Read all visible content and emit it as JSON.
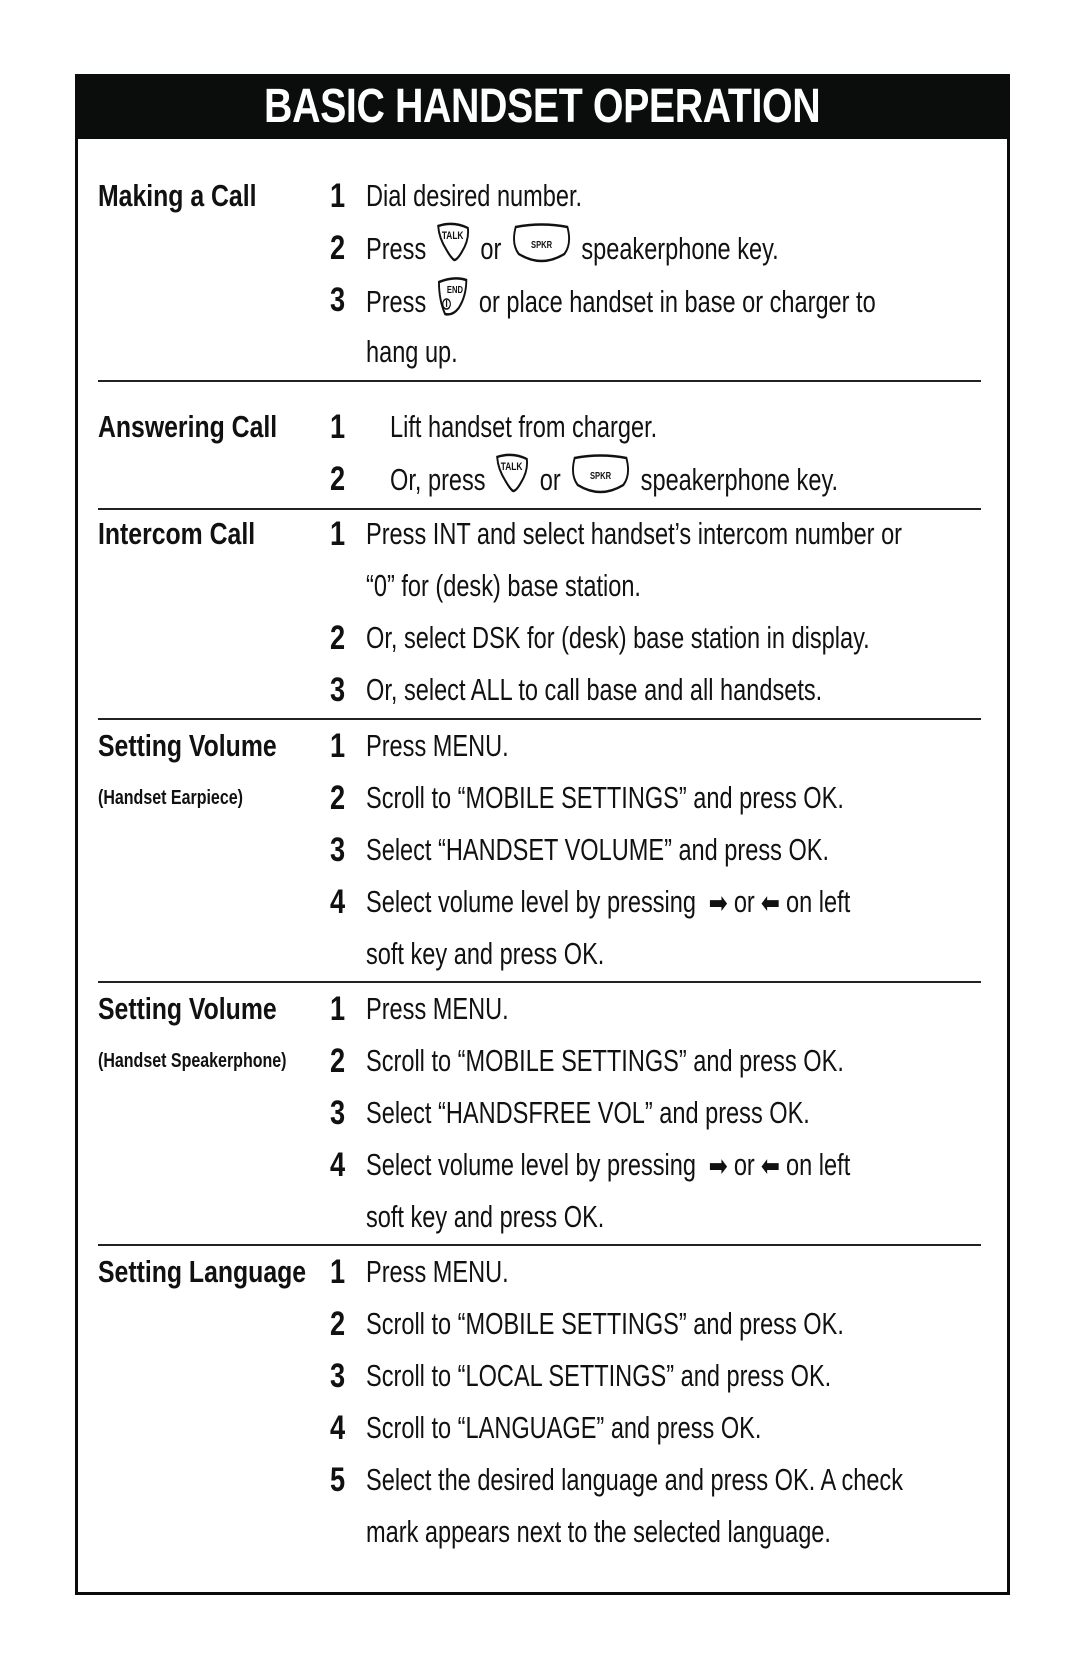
{
  "header": {
    "title": "BASIC HANDSET OPERATION"
  },
  "sections": {
    "making_call": {
      "label": "Making a Call",
      "steps": [
        {
          "num": "1",
          "text": "Dial desired number."
        },
        {
          "num": "2",
          "pre": "Press",
          "mid": "or",
          "post": "speakerphone key.",
          "icon1": "talk-key-icon",
          "icon2": "spkr-key-icon"
        },
        {
          "num": "3",
          "pre": "Press",
          "post": "or place handset in base or charger to",
          "icon1": "end-key-icon"
        },
        {
          "num": "",
          "text": "hang up."
        }
      ]
    },
    "answering_call": {
      "label": "Answering Call",
      "steps": [
        {
          "num": "1",
          "text": "Lift handset from charger."
        },
        {
          "num": "2",
          "pre": "Or, press",
          "mid": "or",
          "post": "speakerphone key.",
          "icon1": "talk-key-icon",
          "icon2": "spkr-key-icon"
        }
      ]
    },
    "intercom_call": {
      "label": "Intercom Call",
      "steps": [
        {
          "num": "1",
          "text": "Press INT and select handset’s intercom number or"
        },
        {
          "num": "",
          "text": "“0” for (desk) base station."
        },
        {
          "num": "2",
          "text": "Or, select DSK for (desk) base station in display."
        },
        {
          "num": "3",
          "text": "Or, select ALL to call base and all handsets."
        }
      ]
    },
    "volume_earpiece": {
      "label": "Setting Volume",
      "sublabel": "(Handset Earpiece)",
      "steps": [
        {
          "num": "1",
          "text": "Press MENU."
        },
        {
          "num": "2",
          "text": "Scroll to “MOBILE SETTINGS” and press OK."
        },
        {
          "num": "3",
          "text": "Select “HANDSET VOLUME” and press OK."
        },
        {
          "num": "4",
          "pre": "Select volume level by pressing",
          "mid": "or",
          "post": "on left",
          "arrow_right": "➡",
          "arrow_left": "⬅"
        },
        {
          "num": "",
          "text": "soft key and press OK."
        }
      ]
    },
    "volume_speaker": {
      "label": "Setting Volume",
      "sublabel": "(Handset Speakerphone)",
      "steps": [
        {
          "num": "1",
          "text": "Press MENU."
        },
        {
          "num": "2",
          "text": "Scroll to “MOBILE SETTINGS” and press OK."
        },
        {
          "num": "3",
          "text": "Select “HANDSFREE VOL” and press OK."
        },
        {
          "num": "4",
          "pre": "Select volume level by pressing",
          "mid": "or",
          "post": "on left",
          "arrow_right": "➡",
          "arrow_left": "⬅"
        },
        {
          "num": "",
          "text": "soft key and press OK."
        }
      ]
    },
    "language": {
      "label": "Setting Language",
      "steps": [
        {
          "num": "1",
          "text": "Press MENU."
        },
        {
          "num": "2",
          "text": "Scroll to “MOBILE SETTINGS” and press OK."
        },
        {
          "num": "3",
          "text": "Scroll to “LOCAL SETTINGS” and press OK."
        },
        {
          "num": "4",
          "text": "Scroll to “LANGUAGE” and press OK."
        },
        {
          "num": "5",
          "text": "Select the desired language and press OK. A check"
        },
        {
          "num": "",
          "text": "mark appears next to the selected language."
        }
      ]
    }
  },
  "icons": {
    "talk_label": "TALK",
    "spkr_label": "SPKR",
    "end_label": "END"
  }
}
